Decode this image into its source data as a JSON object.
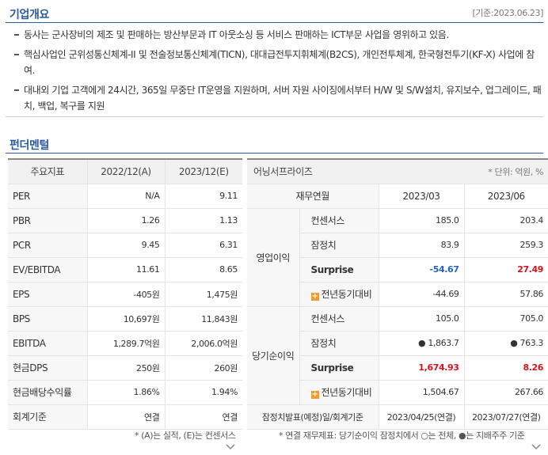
{
  "overview": {
    "title": "기업개요",
    "date": "[기준:2023.06.23]",
    "bullets": [
      "동사는 군사장비의 제조 및 판매하는 방산부문과 IT 아웃소싱 등 서비스 판매하는 ICT부문 사업을 영위하고 있음.",
      "핵심사업인 군위성통신체계-II 및 전술정보통신체계(TICN), 대대급전투지휘체계(B2CS), 개인전투체계, 한국형전투기(KF-X) 사업에 참여.",
      "대내외 기업 고객에게 24시간, 365일 무중단 IT운영을 지원하며, 서버 자원 사이징에서부터 H/W 및 S/W설치, 유지보수, 업그레이드, 패치, 백업, 복구를 지원"
    ]
  },
  "fundamental": {
    "title": "펀더멘털",
    "headers": [
      "주요지표",
      "2022/12(A)",
      "2023/12(E)"
    ],
    "rows": [
      [
        "PER",
        "N/A",
        "9.11"
      ],
      [
        "PBR",
        "1.26",
        "1.13"
      ],
      [
        "PCR",
        "9.45",
        "6.31"
      ],
      [
        "EV/EBITDA",
        "11.61",
        "8.65"
      ],
      [
        "EPS",
        "-405원",
        "1,475원"
      ],
      [
        "BPS",
        "10,697원",
        "11,843원"
      ],
      [
        "EBITDA",
        "1,289.7억원",
        "2,006.0억원"
      ],
      [
        "현금DPS",
        "250원",
        "260원"
      ],
      [
        "현금배당수익률",
        "1.86%",
        "1.94%"
      ],
      [
        "회계기준",
        "연결",
        "연결"
      ]
    ],
    "footnote": "* (A)는 실적, (E)는 컨센서스"
  },
  "earnings": {
    "title": "어닝서프라이즈",
    "unit": "* 단위: 억원, %",
    "col_header": "재무연월",
    "periods": [
      "2023/03",
      "2023/06"
    ],
    "groups": [
      {
        "name": "영업이익",
        "rows": [
          {
            "label": "컨센서스",
            "v1": "185.0",
            "v2": "203.4"
          },
          {
            "label": "잠정치",
            "v1": "83.9",
            "v2": "259.3"
          },
          {
            "label": "Surprise",
            "v1": "-54.67",
            "v2": "27.49"
          },
          {
            "label": "전년동기대비",
            "v1": "-44.69",
            "v2": "57.86"
          }
        ]
      },
      {
        "name": "당기순이익",
        "rows": [
          {
            "label": "컨센서스",
            "v1": "105.0",
            "v2": "705.0"
          },
          {
            "label": "잠정치",
            "v1": "● 1,863.7",
            "v2": "● 763.3"
          },
          {
            "label": "Surprise",
            "v1": "1,674.93",
            "v2": "8.26"
          },
          {
            "label": "전년동기대비",
            "v1": "1,504.67",
            "v2": "267.66"
          }
        ]
      }
    ],
    "release_label": "잠정치발표(예정)일/회계기준",
    "release": [
      "2023/04/25(연결)",
      "2023/07/27(연결)"
    ],
    "footnote": "* 연결 재무제표: 당기순이익 잠정치에서 ○는 전체, ●는 지배주주 기준"
  },
  "colors": {
    "accent": "#2b5aa0",
    "negative": "#2463c0",
    "positive": "#d4141a",
    "plus_icon": "#f39a2b"
  }
}
